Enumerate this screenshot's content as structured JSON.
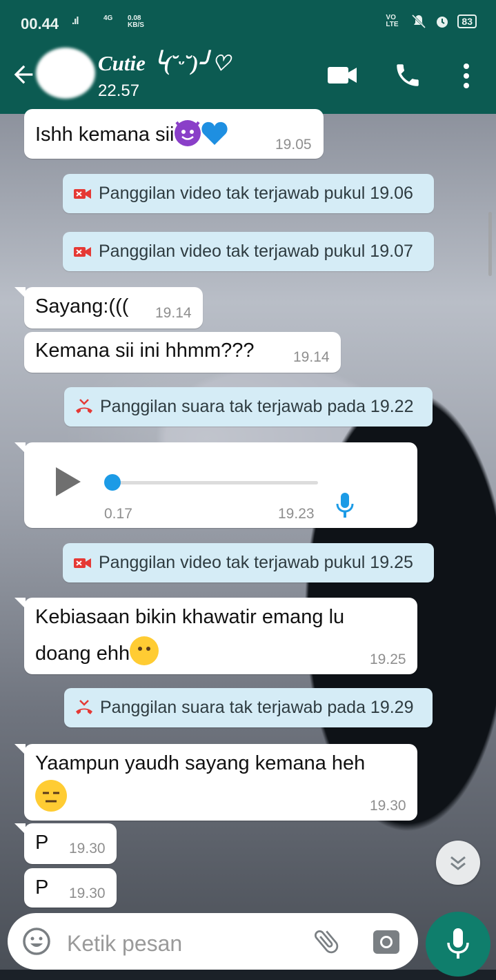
{
  "status_bar": {
    "time": "00.44",
    "signal": ".ıl",
    "network": "4G",
    "speed_value": "0.08",
    "speed_unit": "KB/S",
    "volte": "VO LTE",
    "battery": "83"
  },
  "header": {
    "contact_name": "Cutie ╰(˘ᵕ˘)╯♡",
    "last_seen": "22.57"
  },
  "messages": [
    {
      "type": "text",
      "text": "Ishh kemana sii",
      "emoji": [
        "smiling-devil",
        "blue-heart"
      ],
      "time": "19.05"
    },
    {
      "type": "missed_call",
      "icon": "missed-video-call-icon",
      "text": "Panggilan video tak terjawab pukul 19.06"
    },
    {
      "type": "missed_call",
      "icon": "missed-video-call-icon",
      "text": "Panggilan video tak terjawab pukul 19.07"
    },
    {
      "type": "text",
      "text": "Sayang:(((",
      "time": "19.14"
    },
    {
      "type": "text",
      "text": "Kemana sii ini hhmm???",
      "time": "19.14"
    },
    {
      "type": "missed_call",
      "icon": "missed-voice-call-icon",
      "text": "Panggilan suara tak terjawab pada 19.22"
    },
    {
      "type": "voice_note",
      "duration": "0.17",
      "time": "19.23",
      "progress": 0.0
    },
    {
      "type": "missed_call",
      "icon": "missed-video-call-icon",
      "text": "Panggilan video tak terjawab pukul 19.25"
    },
    {
      "type": "text",
      "line1": "Kebiasaan bikin khawatir emang lu",
      "line2": "doang ehh",
      "emoji": [
        "hushed-face"
      ],
      "time": "19.25"
    },
    {
      "type": "missed_call",
      "icon": "missed-voice-call-icon",
      "text": "Panggilan suara tak terjawab pada 19.29"
    },
    {
      "type": "text",
      "line1": "Yaampun yaudh sayang kemana heh",
      "emoji": [
        "expressionless-face"
      ],
      "time": "19.30"
    },
    {
      "type": "text",
      "text": "P",
      "time": "19.30"
    },
    {
      "type": "text",
      "text": "P",
      "time": "19.30"
    }
  ],
  "composer": {
    "placeholder": "Ketik pesan"
  },
  "colors": {
    "header": "#0c5b52",
    "accent": "#0f7e6c",
    "system_bubble": "#d5ecf6",
    "missed_call": "#e53935",
    "voice": "#1c9be6"
  }
}
